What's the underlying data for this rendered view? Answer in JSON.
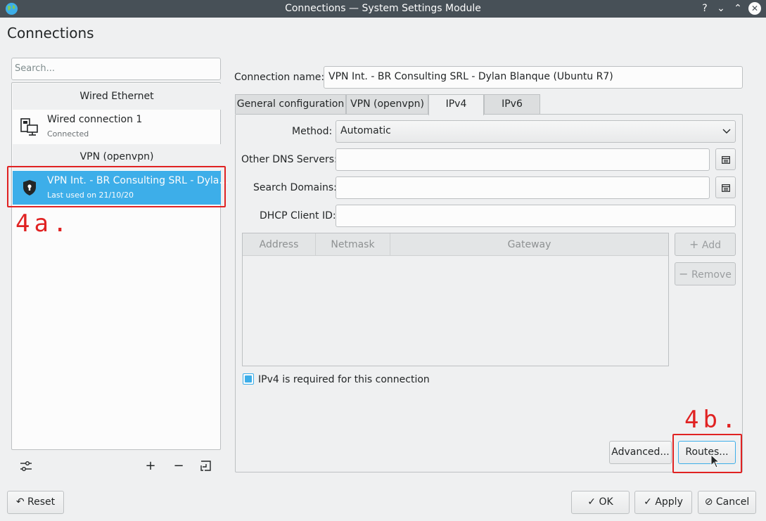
{
  "window": {
    "title": "Connections — System Settings Module",
    "help_glyph": "?",
    "minimize_glyph": "⌄",
    "maximize_glyph": "⌃",
    "close_glyph": "✕"
  },
  "page_title": "Connections",
  "search": {
    "placeholder": "Search..."
  },
  "sections": {
    "wired": "Wired Ethernet",
    "vpn": "VPN (openvpn)"
  },
  "connections": [
    {
      "name": "Wired connection 1",
      "status": "Connected",
      "icon": "wired-network-icon"
    },
    {
      "name": "VPN Int. - BR Consulting SRL - Dyla…",
      "status": "Last used on 21/10/20",
      "icon": "vpn-shield-icon"
    }
  ],
  "annotations": {
    "a": "4a.",
    "b": "4b."
  },
  "left_toolbar": {
    "configure": "⊹",
    "add": "+",
    "remove": "−",
    "import": "⎘"
  },
  "form": {
    "connection_name_label": "Connection name:",
    "connection_name_value": "VPN Int. - BR Consulting SRL - Dylan Blanque (Ubuntu R7)",
    "tabs": [
      "General configuration",
      "VPN (openvpn)",
      "IPv4",
      "IPv6"
    ],
    "active_tab": "IPv4",
    "method_label": "Method:",
    "method_value": "Automatic",
    "dns_label": "Other DNS Servers:",
    "dns_value": "",
    "search_domains_label": "Search Domains:",
    "search_domains_value": "",
    "dhcp_label": "DHCP Client ID:",
    "dhcp_value": "",
    "table_columns": [
      "Address",
      "Netmask",
      "Gateway"
    ],
    "add_label": "Add",
    "remove_label": "Remove",
    "ipv4_required_label": "IPv4 is required for this connection",
    "ipv4_required_checked": true,
    "advanced_label": "Advanced...",
    "routes_label": "Routes..."
  },
  "footer": {
    "reset_label": "Reset",
    "ok_label": "OK",
    "apply_label": "Apply",
    "cancel_label": "Cancel"
  },
  "colors": {
    "accent": "#3daee9",
    "annotation_red": "#e02222",
    "titlebar": "#475057"
  }
}
